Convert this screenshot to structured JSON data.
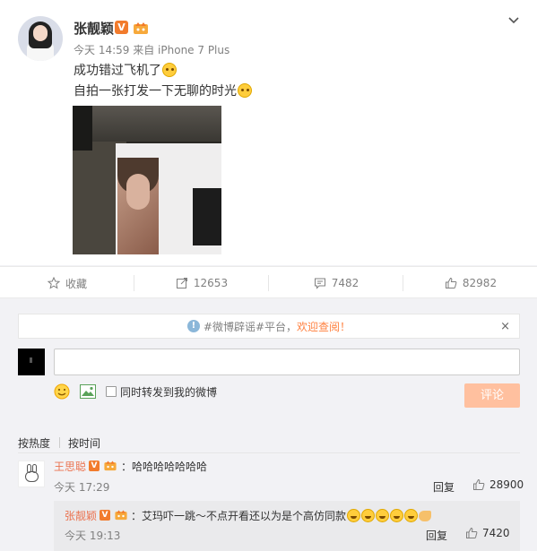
{
  "post": {
    "username": "张靓颖",
    "verified_badge": "V",
    "time": "今天 14:59",
    "source": "来自 iPhone 7 Plus",
    "line1": "成功错过飞机了",
    "line2": "自拍一张打发一下无聊的时光"
  },
  "actions": {
    "favorite_label": "收藏",
    "repost_count": "12653",
    "comment_count": "7482",
    "like_count": "82982"
  },
  "notice": {
    "text_prefix": "#微博辟谣#平台，",
    "text_highlight": "欢迎查阅！",
    "close_label": "×"
  },
  "composer": {
    "input_value": "",
    "repost_label": "同时转发到我的微博",
    "submit_label": "评论"
  },
  "sort": {
    "by_hot": "按热度",
    "by_time": "按时间"
  },
  "comments": [
    {
      "name": "王思聪",
      "badge": "V",
      "text": "：哈哈哈哈哈哈哈",
      "time": "今天 17:29",
      "reply_label": "回复",
      "likes": "28900"
    }
  ],
  "reply": {
    "name": "张靓颖",
    "badge": "V",
    "text": "：艾玛吓一跳～不点开看还以为是个高仿同款",
    "time": "今天 19:13",
    "reply_label": "回复",
    "likes": "7420"
  },
  "colors": {
    "accent": "#ff8140",
    "name_link": "#eb7350",
    "badge": "#f27b2c",
    "submit_disabled": "#ffc09f"
  }
}
